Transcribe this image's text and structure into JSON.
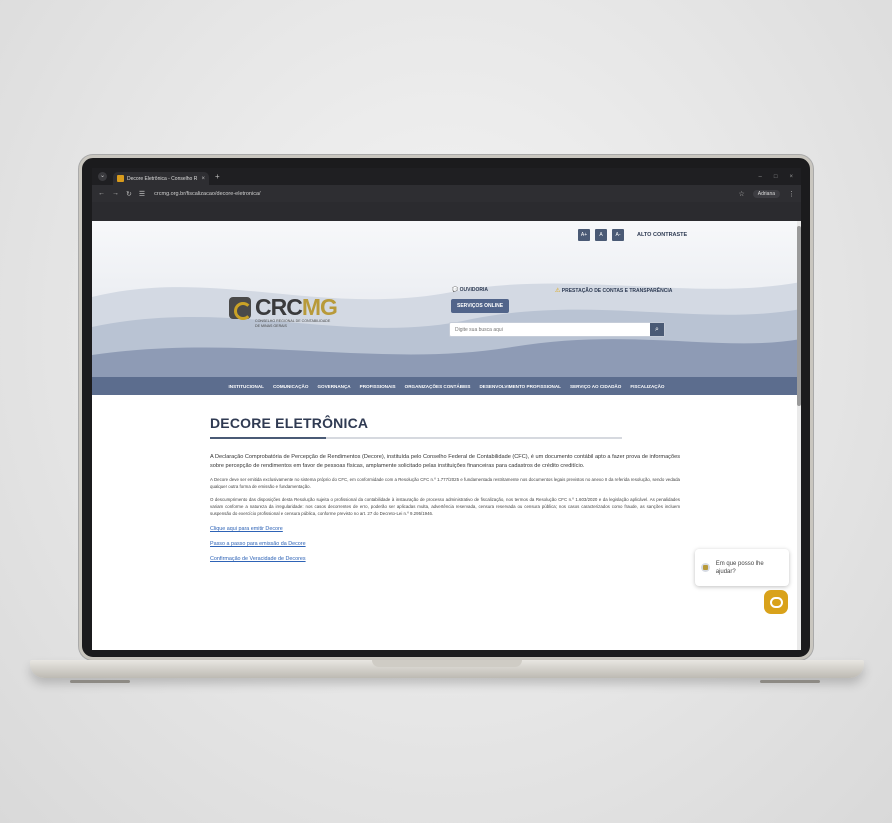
{
  "browser": {
    "tab_title": "Decore Eletrônica - Conselho R",
    "tab_close": "×",
    "tab_new": "+",
    "window_controls": [
      "–",
      "□",
      "×"
    ],
    "url": "crcmg.org.br/fiscalizacao/decore-eletronica/",
    "profile_label": "Adriana"
  },
  "header": {
    "font_buttons": [
      "A+",
      "A",
      "A-"
    ],
    "contrast_label": "ALTO CONTRASTE",
    "logo_crc": "CRC",
    "logo_mg": "MG",
    "logo_subtitle": "CONSELHO REGIONAL DE CONTABILIDADE DE MINAS GERAIS",
    "ouvidoria": "OUVIDORIA",
    "prestacao": "PRESTAÇÃO DE CONTAS E TRANSPARÊNCIA",
    "servicos": "SERVIÇOS ONLINE",
    "search_placeholder": "Digite sua busca aqui"
  },
  "nav": {
    "items": [
      "INSTITUCIONAL",
      "COMUNICAÇÃO",
      "GOVERNANÇA",
      "PROFISSIONAIS",
      "ORGANIZAÇÕES CONTÁBEIS",
      "DESENVOLVIMENTO PROFISSIONAL",
      "SERVIÇO AO CIDADÃO",
      "FISCALIZAÇÃO"
    ]
  },
  "content": {
    "title": "DECORE ELETRÔNICA",
    "paragraph1": "A Declaração Comprobatória de Percepção de Rendimentos (Decore), instituída pelo Conselho Federal de Contabilidade (CFC), é um documento contábil apto a fazer prova de informações sobre percepção de rendimentos em favor de pessoas físicas, amplamente solicitado pelas instituições financeiras para cadastros de crédito creditício.",
    "paragraph2": "A Decore deve ser emitida exclusivamente no sistema próprio do CFC, em conformidade com a Resolução CFC n.º 1.777/2025 e fundamentada restritamente nos documentos legais previstos no anexo II da referida resolução, sendo vedada qualquer outra forma de emissão e fundamentação.",
    "paragraph3": "O descumprimento das disposições desta Resolução sujeita o profissional da contabilidade à instauração de processo administrativo de fiscalização, nos termos da Resolução CFC n.º 1.603/2020 e da legislação aplicável. As penalidades variam conforme a natureza da irregularidade: nos casos decorrentes de erro, poderão ser aplicadas multa, advertência reservada, censura reservada ou censura pública; nos casos caracterizados como fraude, as sanções incluem suspensão do exercício profissional e censura pública, conforme previsto no art. 27 do Decreto-Lei n.º 9.295/1946.",
    "links": [
      "Clique aqui para emitir Decore",
      "Passo a passo para emissão da Decore",
      "Confirmação de Veracidade de Decores"
    ]
  },
  "chat": {
    "text": "Em que posso lhe ajudar?"
  }
}
